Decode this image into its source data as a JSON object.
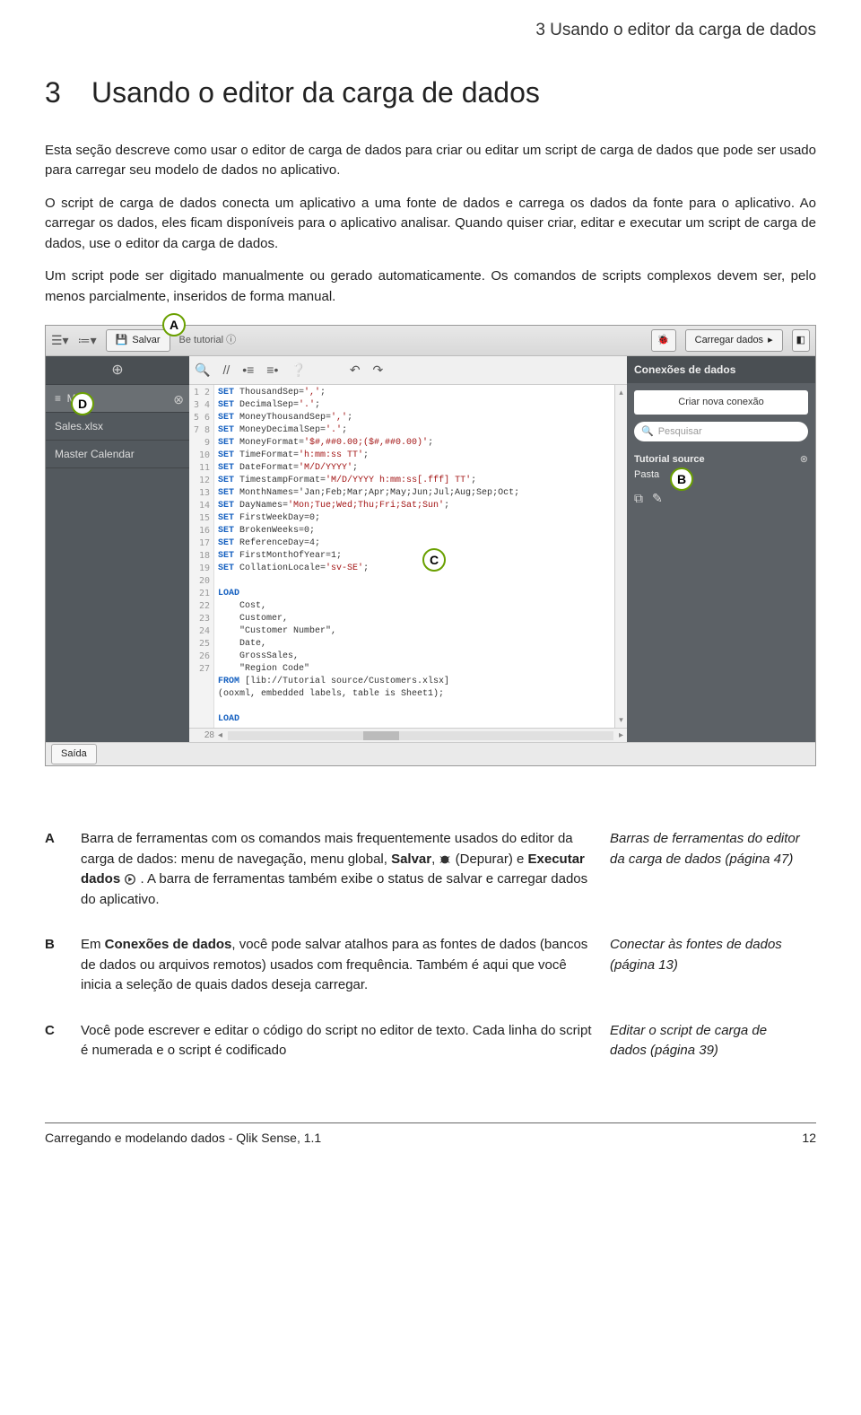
{
  "page_header": "3   Usando o editor da carga de dados",
  "section": {
    "num": "3",
    "title": "Usando o editor da carga de dados"
  },
  "para1": "Esta seção descreve como usar o editor de carga de dados para criar ou editar um script de carga de dados que pode ser usado para carregar seu modelo de dados no aplicativo.",
  "para2": "O script de carga de dados conecta um aplicativo a uma fonte de dados e carrega os dados da fonte para o aplicativo. Ao carregar os dados, eles ficam disponíveis para o aplicativo analisar. Quando quiser criar, editar e executar um script de carga de dados, use o editor da carga de dados.",
  "para3": "Um script pode ser digitado manualmente ou gerado automaticamente. Os comandos de scripts complexos devem ser, pelo menos parcialmente, inseridos de forma manual.",
  "screenshot": {
    "toolbar": {
      "save": "Salvar",
      "tutorial": "tutorial",
      "load": "Carregar dados"
    },
    "left": {
      "main": "Main",
      "file": "Sales.xlsx",
      "cal": "Master Calendar"
    },
    "right": {
      "head": "Conexões de dados",
      "new": "Criar nova conexão",
      "search": "Pesquisar",
      "conn_name": "Tutorial source",
      "conn_type": "Pasta"
    },
    "code_lines": [
      {
        "n": "1",
        "t": "SET ThousandSep=',';"
      },
      {
        "n": "2",
        "t": "SET DecimalSep='.';"
      },
      {
        "n": "3",
        "t": "SET MoneyThousandSep=',';"
      },
      {
        "n": "4",
        "t": "SET MoneyDecimalSep='.';"
      },
      {
        "n": "5",
        "t": "SET MoneyFormat='$#,##0.00;($#,##0.00)';"
      },
      {
        "n": "6",
        "t": "SET TimeFormat='h:mm:ss TT';"
      },
      {
        "n": "7",
        "t": "SET DateFormat='M/D/YYYY';"
      },
      {
        "n": "8",
        "t": "SET TimestampFormat='M/D/YYYY h:mm:ss[.fff] TT';"
      },
      {
        "n": "9",
        "t": "SET MonthNames='Jan;Feb;Mar;Apr;May;Jun;Jul;Aug;Sep;Oct;"
      },
      {
        "n": "10",
        "t": "SET DayNames='Mon;Tue;Wed;Thu;Fri;Sat;Sun';"
      },
      {
        "n": "11",
        "t": "SET FirstWeekDay=0;"
      },
      {
        "n": "12",
        "t": "SET BrokenWeeks=0;"
      },
      {
        "n": "13",
        "t": "SET ReferenceDay=4;"
      },
      {
        "n": "14",
        "t": "SET FirstMonthOfYear=1;"
      },
      {
        "n": "15",
        "t": "SET CollationLocale='sv-SE';"
      },
      {
        "n": "16",
        "t": ""
      },
      {
        "n": "17",
        "t": "LOAD"
      },
      {
        "n": "18",
        "t": "    Cost,"
      },
      {
        "n": "19",
        "t": "    Customer,"
      },
      {
        "n": "20",
        "t": "    \"Customer Number\","
      },
      {
        "n": "21",
        "t": "    Date,"
      },
      {
        "n": "22",
        "t": "    GrossSales,"
      },
      {
        "n": "23",
        "t": "    \"Region Code\""
      },
      {
        "n": "24",
        "t": "FROM [lib://Tutorial source/Customers.xlsx]"
      },
      {
        "n": "25",
        "t": "(ooxml, embedded labels, table is Sheet1);"
      },
      {
        "n": "26",
        "t": ""
      },
      {
        "n": "27",
        "t": "LOAD"
      },
      {
        "n": "28",
        "t": ""
      }
    ],
    "saida": "Saída",
    "markers": {
      "A": "A",
      "B": "B",
      "C": "C",
      "D": "D"
    }
  },
  "table": {
    "rows": [
      {
        "key": "A",
        "text_pre": "Barra de ferramentas com os comandos mais frequentemente usados do editor da carga de dados: menu de navegação, menu global, ",
        "bold1": "Salvar",
        "mid": ",  (Depurar) e ",
        "bold2": "Executar dados",
        "text_post": " . A barra de ferramentas também exibe o status de salvar e carregar dados do aplicativo.",
        "ref": "Barras de ferramentas do editor da carga de dados (página 47)"
      },
      {
        "key": "B",
        "text": "Em Conexões de dados, você pode salvar atalhos para as fontes de dados (bancos de dados ou arquivos remotos) usados com frequência. Também é aqui que você inicia a seleção de quais dados deseja carregar.",
        "bold_inline": "Conexões de dados",
        "ref": "Conectar às fontes de dados (página 13)"
      },
      {
        "key": "C",
        "text": "Você pode escrever e editar o código do script no editor de texto. Cada linha do script é numerada e o script é codificado",
        "ref": "Editar o script de carga de dados (página 39)"
      }
    ]
  },
  "footer": {
    "left": "Carregando e modelando dados - Qlik Sense, 1.1",
    "right": "12"
  }
}
